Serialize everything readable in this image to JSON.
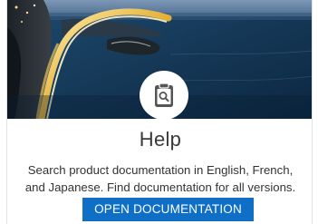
{
  "card": {
    "title": "Help",
    "description": "Search product documentation in English, French, and Japanese. Find documentation for all versions.",
    "button_label": "OPEN DOCUMENTATION",
    "icon": "document-search-icon",
    "hero_image": "coastal-highway-night-photo"
  },
  "colors": {
    "button": "#0f6fc6",
    "icon_fg": "#555555",
    "title_text": "#3a3a3a"
  }
}
